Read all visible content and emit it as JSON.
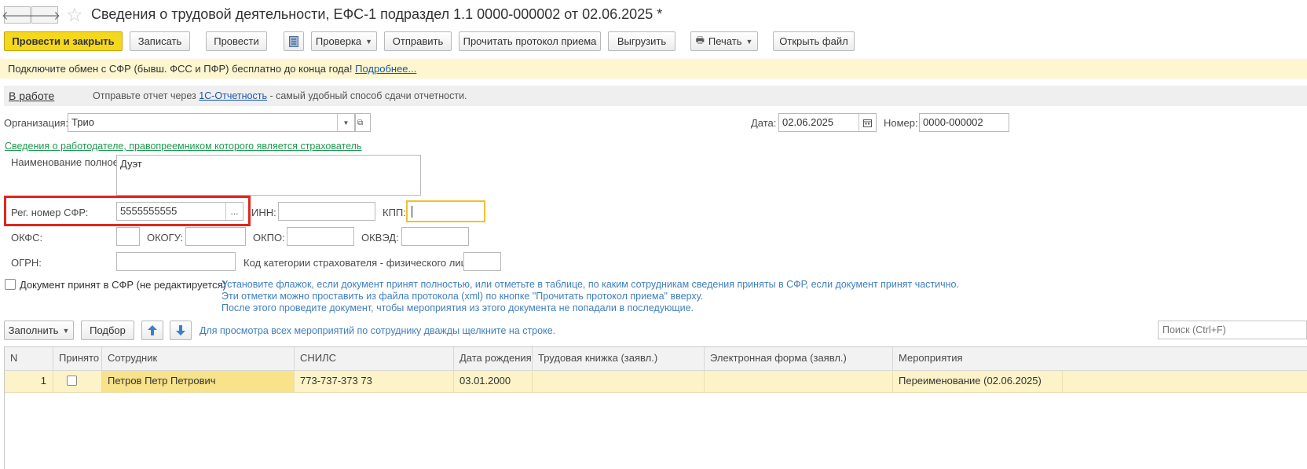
{
  "nav": {
    "back_icon": "arrow-left-icon",
    "forward_icon": "arrow-right-icon",
    "favorite_icon": "star-icon"
  },
  "window": {
    "title": "Сведения о трудовой деятельности, ЕФС-1 подраздел 1.1 0000-000002 от 02.06.2025 *"
  },
  "toolbar": {
    "post_close": "Провести и закрыть",
    "save": "Записать",
    "post": "Провести",
    "check": "Проверка",
    "send": "Отправить",
    "read_protocol": "Прочитать протокол приема",
    "export": "Выгрузить",
    "print": "Печать",
    "open_file": "Открыть файл"
  },
  "banner": {
    "text": "Подключите обмен с СФР (бывш. ФСС и ПФР) бесплатно до конца года!",
    "link": "Подробнее..."
  },
  "status": {
    "state": "В работе",
    "text_before": "Отправьте отчет через",
    "link": "1С-Отчетность",
    "text_after": "- самый удобный способ сдачи отчетности."
  },
  "form": {
    "org_label": "Организация:",
    "org_value": "Трио",
    "date_label": "Дата:",
    "date_value": "02.06.2025",
    "number_label": "Номер:",
    "number_value": "0000-000002",
    "employer_link": "Сведения о работодателе, правопреемником которого является страхователь",
    "fullname_label": "Наименование полное:",
    "fullname_value": "Дуэт",
    "reg_label": "Рег. номер СФР:",
    "reg_value": "5555555555",
    "inn_label": "ИНН:",
    "inn_value": "",
    "kpp_label": "КПП:",
    "kpp_value": "",
    "okfs_label": "ОКФС:",
    "okogu_label": "ОКОГУ:",
    "okpo_label": "ОКПО:",
    "okved_label": "ОКВЭД:",
    "ogrn_label": "ОГРН:",
    "category_label": "Код категории страхователя - физического лица:",
    "accepted_label": "Документ принят в СФР (не редактируется)",
    "accepted_checked": false,
    "hint_lines": [
      "Установите флажок, если документ принят полностью, или отметьте в таблице, по каким сотрудникам сведения приняты в СФР, если документ принят частично.",
      "Эти отметки можно проставить из файла протокола (xml) по кнопке \"Прочитать протокол приема\" вверху.",
      "После этого проведите документ, чтобы мероприятия из этого документа не попадали в последующие."
    ]
  },
  "table_toolbar": {
    "fill": "Заполнить",
    "pick": "Подбор",
    "hint": "Для просмотра всех мероприятий по сотруднику дважды щелкните на строке.",
    "search_placeholder": "Поиск (Ctrl+F)"
  },
  "table": {
    "headers": [
      "N",
      "Принято",
      "Сотрудник",
      "СНИЛС",
      "Дата рождения",
      "Трудовая книжка (заявл.)",
      "Электронная форма (заявл.)",
      "Мероприятия"
    ],
    "rows": [
      {
        "n": "1",
        "accepted": false,
        "employee": "Петров Петр Петрович",
        "snils": "773-737-373 73",
        "birth": "03.01.2000",
        "book": "",
        "eform": "",
        "events": "Переименование (02.06.2025)"
      }
    ]
  },
  "colors": {
    "primary": "#f5d81c",
    "banner": "#fdf6cf",
    "highlight": "#e0261c",
    "row": "#fcf3c8",
    "selected_cell": "#f8e28a",
    "focus": "#f0c030"
  }
}
